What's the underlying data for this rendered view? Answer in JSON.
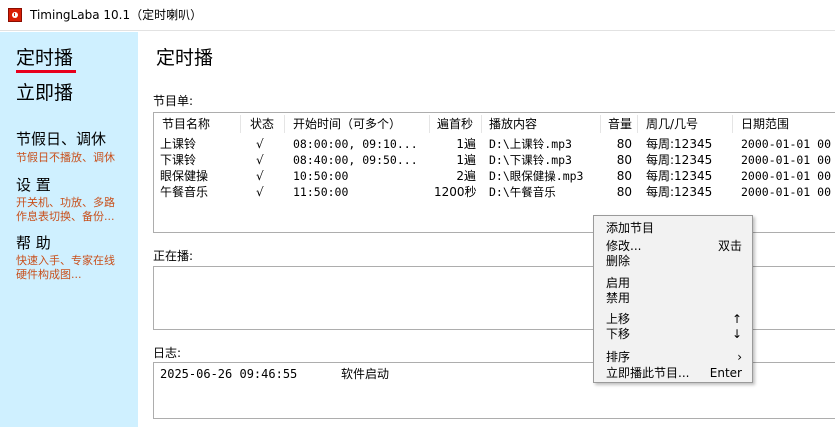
{
  "window": {
    "title": "TimingLaba 10.1（定时喇叭）",
    "icon": "app-icon"
  },
  "sidebar": {
    "nav": [
      {
        "label": "定时播",
        "active": true
      },
      {
        "label": "立即播",
        "active": false
      }
    ],
    "sections": [
      {
        "heading": "节假日、调休",
        "lines": [
          "节假日不播放、调休"
        ]
      },
      {
        "heading": "设 置",
        "lines": [
          "开关机、功放、多路",
          "作息表切换、备份..."
        ]
      },
      {
        "heading": "帮 助",
        "lines": [
          "快速入手、专家在线",
          "硬件构成图..."
        ]
      }
    ],
    "accent_color": "#e8001c",
    "background": "#cff0ff"
  },
  "main": {
    "title": "定时播",
    "program_list_label": "节目单:",
    "columns": [
      "节目名称",
      "状态",
      "开始时间（可多个）",
      "遍首秒",
      "播放内容",
      "音量",
      "周几/几号",
      "日期范围"
    ],
    "rows": [
      [
        "上课铃",
        "√",
        "08:00:00, 09:10...",
        "1遍",
        "D:\\上课铃.mp3",
        "80",
        "每周:12345",
        "2000-01-01 00"
      ],
      [
        "下课铃",
        "√",
        "08:40:00, 09:50...",
        "1遍",
        "D:\\下课铃.mp3",
        "80",
        "每周:12345",
        "2000-01-01 00"
      ],
      [
        "眼保健操",
        "√",
        "10:50:00",
        "2遍",
        "D:\\眼保健操.mp3",
        "80",
        "每周:12345",
        "2000-01-01 00"
      ],
      [
        "午餐音乐",
        "√",
        "11:50:00",
        "1200秒",
        "D:\\午餐音乐",
        "80",
        "每周:12345",
        "2000-01-01 00"
      ]
    ],
    "now_playing_label": "正在播:",
    "log_label": "日志:",
    "log": [
      {
        "time": "2025-06-26 09:46:55",
        "message": "软件启动"
      }
    ]
  },
  "context_menu": {
    "items": [
      {
        "label": "添加节目",
        "shortcut": ""
      },
      {
        "label": "修改...",
        "shortcut": "双击"
      },
      {
        "label": "删除",
        "shortcut": ""
      },
      {
        "label": "启用",
        "shortcut": ""
      },
      {
        "label": "禁用",
        "shortcut": ""
      },
      {
        "label": "上移",
        "shortcut": "↑"
      },
      {
        "label": "下移",
        "shortcut": "↓"
      },
      {
        "label": "排序",
        "shortcut": "›"
      },
      {
        "label": "立即播此节目...",
        "shortcut": "Enter"
      }
    ]
  }
}
